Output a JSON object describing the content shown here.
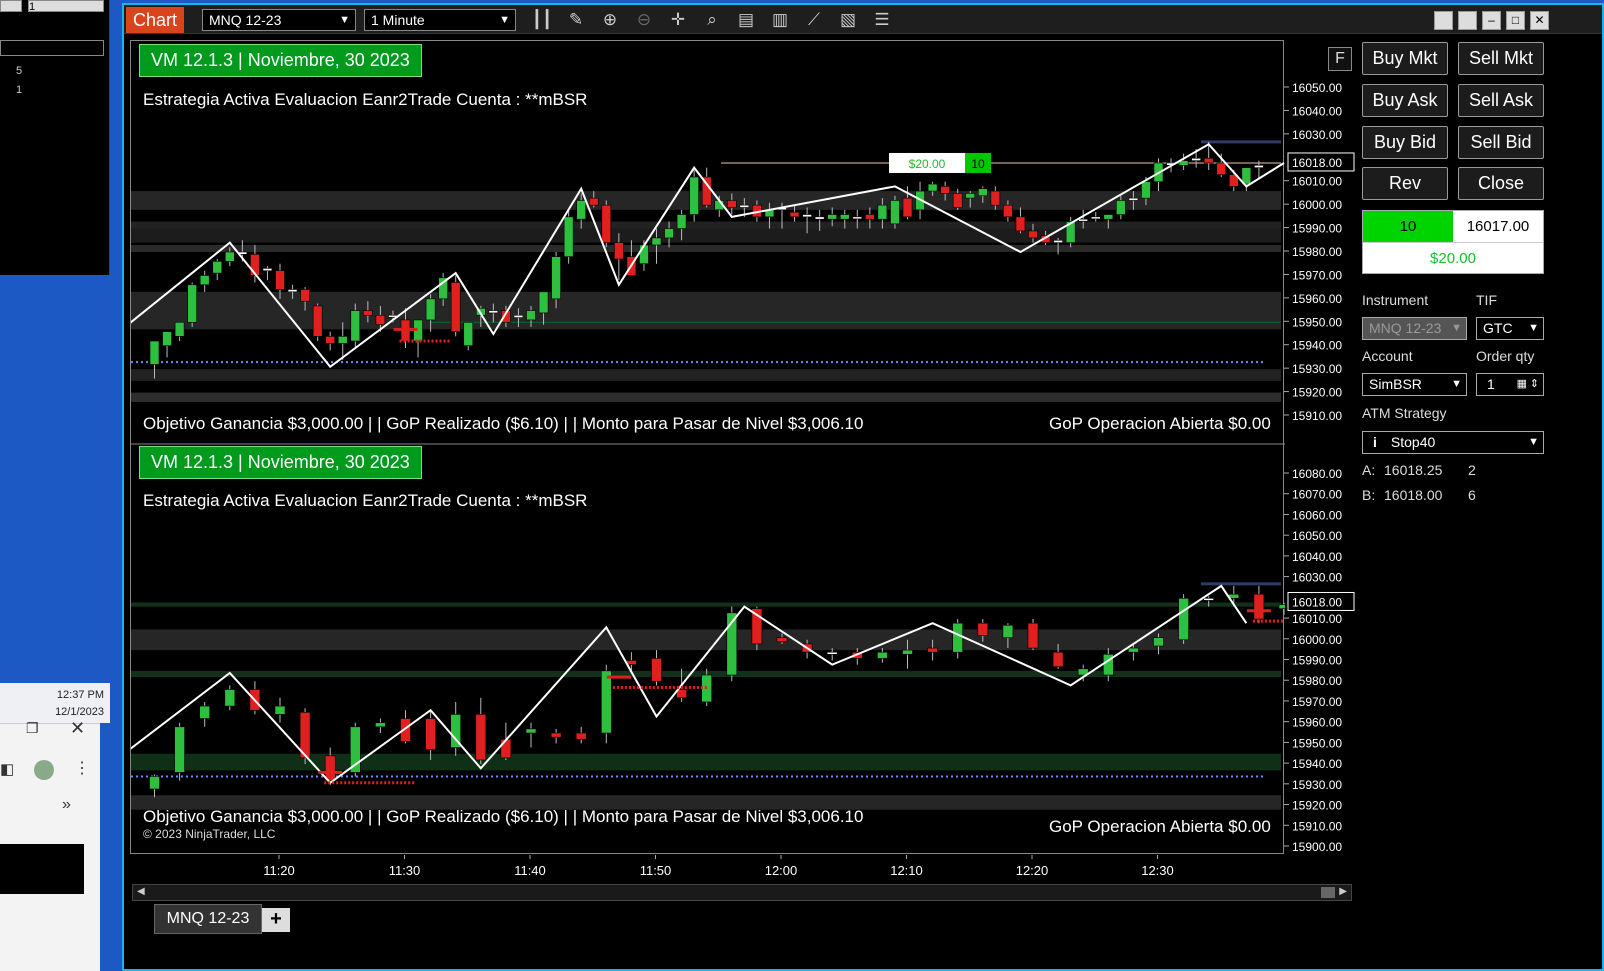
{
  "background": {
    "clock_time": "12:37 PM",
    "clock_date": "12/1/2023",
    "list_values": [
      "5",
      "1"
    ],
    "field_value": "1"
  },
  "window": {
    "title": "Chart",
    "instrument_selector": "MNQ 12-23",
    "interval_selector": "1 Minute",
    "toolbar_icons": [
      "bar-type-icon",
      "draw-pencil-icon",
      "zoom-in-icon",
      "zoom-out-icon",
      "crosshair-icon",
      "data-box-icon",
      "properties-icon",
      "chart-trader-icon",
      "indicators-icon",
      "strategies-icon",
      "list-icon"
    ],
    "tab_label": "MNQ 12-23",
    "tab_add": "+",
    "f_button": "F"
  },
  "panes": [
    {
      "title": "VM 12.1.3 | Noviembre, 30  2023",
      "strategy_text": "Estrategia Activa Evaluacion Eanr2Trade Cuenta : **mBSR",
      "footer_text": "Objetivo Ganancia $3,000.00  | | GoP Realizado ($6.10)  | | Monto para Pasar de Nivel $3,006.10",
      "open_pnl_text": "GoP Operacion Abierta  $0.00",
      "y_ticks": [
        "16050.00",
        "16040.00",
        "16030.00",
        "16010.00",
        "16000.00",
        "15990.00",
        "15980.00",
        "15970.00",
        "15960.00",
        "15950.00",
        "15940.00",
        "15930.00",
        "15920.00",
        "15910.00"
      ],
      "price_tag": "16018.00",
      "position_pnl": "$20.00",
      "position_qty": "10"
    },
    {
      "title": "VM 12.1.3 | Noviembre, 30  2023",
      "strategy_text": "Estrategia Activa Evaluacion Eanr2Trade Cuenta : **mBSR",
      "footer_text": "Objetivo Ganancia $3,000.00  | | GoP Realizado ($6.10)  | | Monto para Pasar de Nivel $3,006.10",
      "open_pnl_text": "GoP Operacion Abierta  $0.00",
      "y_ticks": [
        "16080.00",
        "16070.00",
        "16060.00",
        "16050.00",
        "16040.00",
        "16030.00",
        "16010.00",
        "16000.00",
        "15990.00",
        "15980.00",
        "15970.00",
        "15960.00",
        "15950.00",
        "15940.00",
        "15930.00",
        "15920.00",
        "15910.00",
        "15900.00"
      ],
      "price_tag": "16018.00"
    }
  ],
  "x_ticks": [
    "11:20",
    "11:30",
    "11:40",
    "11:50",
    "12:00",
    "12:10",
    "12:20",
    "12:30"
  ],
  "copyright": "© 2023 NinjaTrader, LLC",
  "order_panel": {
    "buttons": {
      "buy_mkt": "Buy Mkt",
      "sell_mkt": "Sell Mkt",
      "buy_ask": "Buy Ask",
      "sell_ask": "Sell Ask",
      "buy_bid": "Buy Bid",
      "sell_bid": "Sell Bid",
      "rev": "Rev",
      "close": "Close"
    },
    "position_qty": "10",
    "position_price": "16017.00",
    "position_pnl": "$20.00",
    "instrument_label": "Instrument",
    "instrument_value": "MNQ 12-23",
    "tif_label": "TIF",
    "tif_value": "GTC",
    "account_label": "Account",
    "account_value": "SimBSR",
    "qty_label": "Order qty",
    "qty_value": "1",
    "atm_label": "ATM Strategy",
    "atm_value": "Stop40",
    "ask_label": "A:",
    "ask_price": "16018.25",
    "ask_size": "2",
    "bid_label": "B:",
    "bid_price": "16018.00",
    "bid_size": "6"
  },
  "colors": {
    "accent_orange": "#d9441c",
    "bull_candle": "#2fbf3f",
    "bear_candle": "#e01f1f",
    "title_green": "#009a1c",
    "window_border": "#17b4f0"
  }
}
